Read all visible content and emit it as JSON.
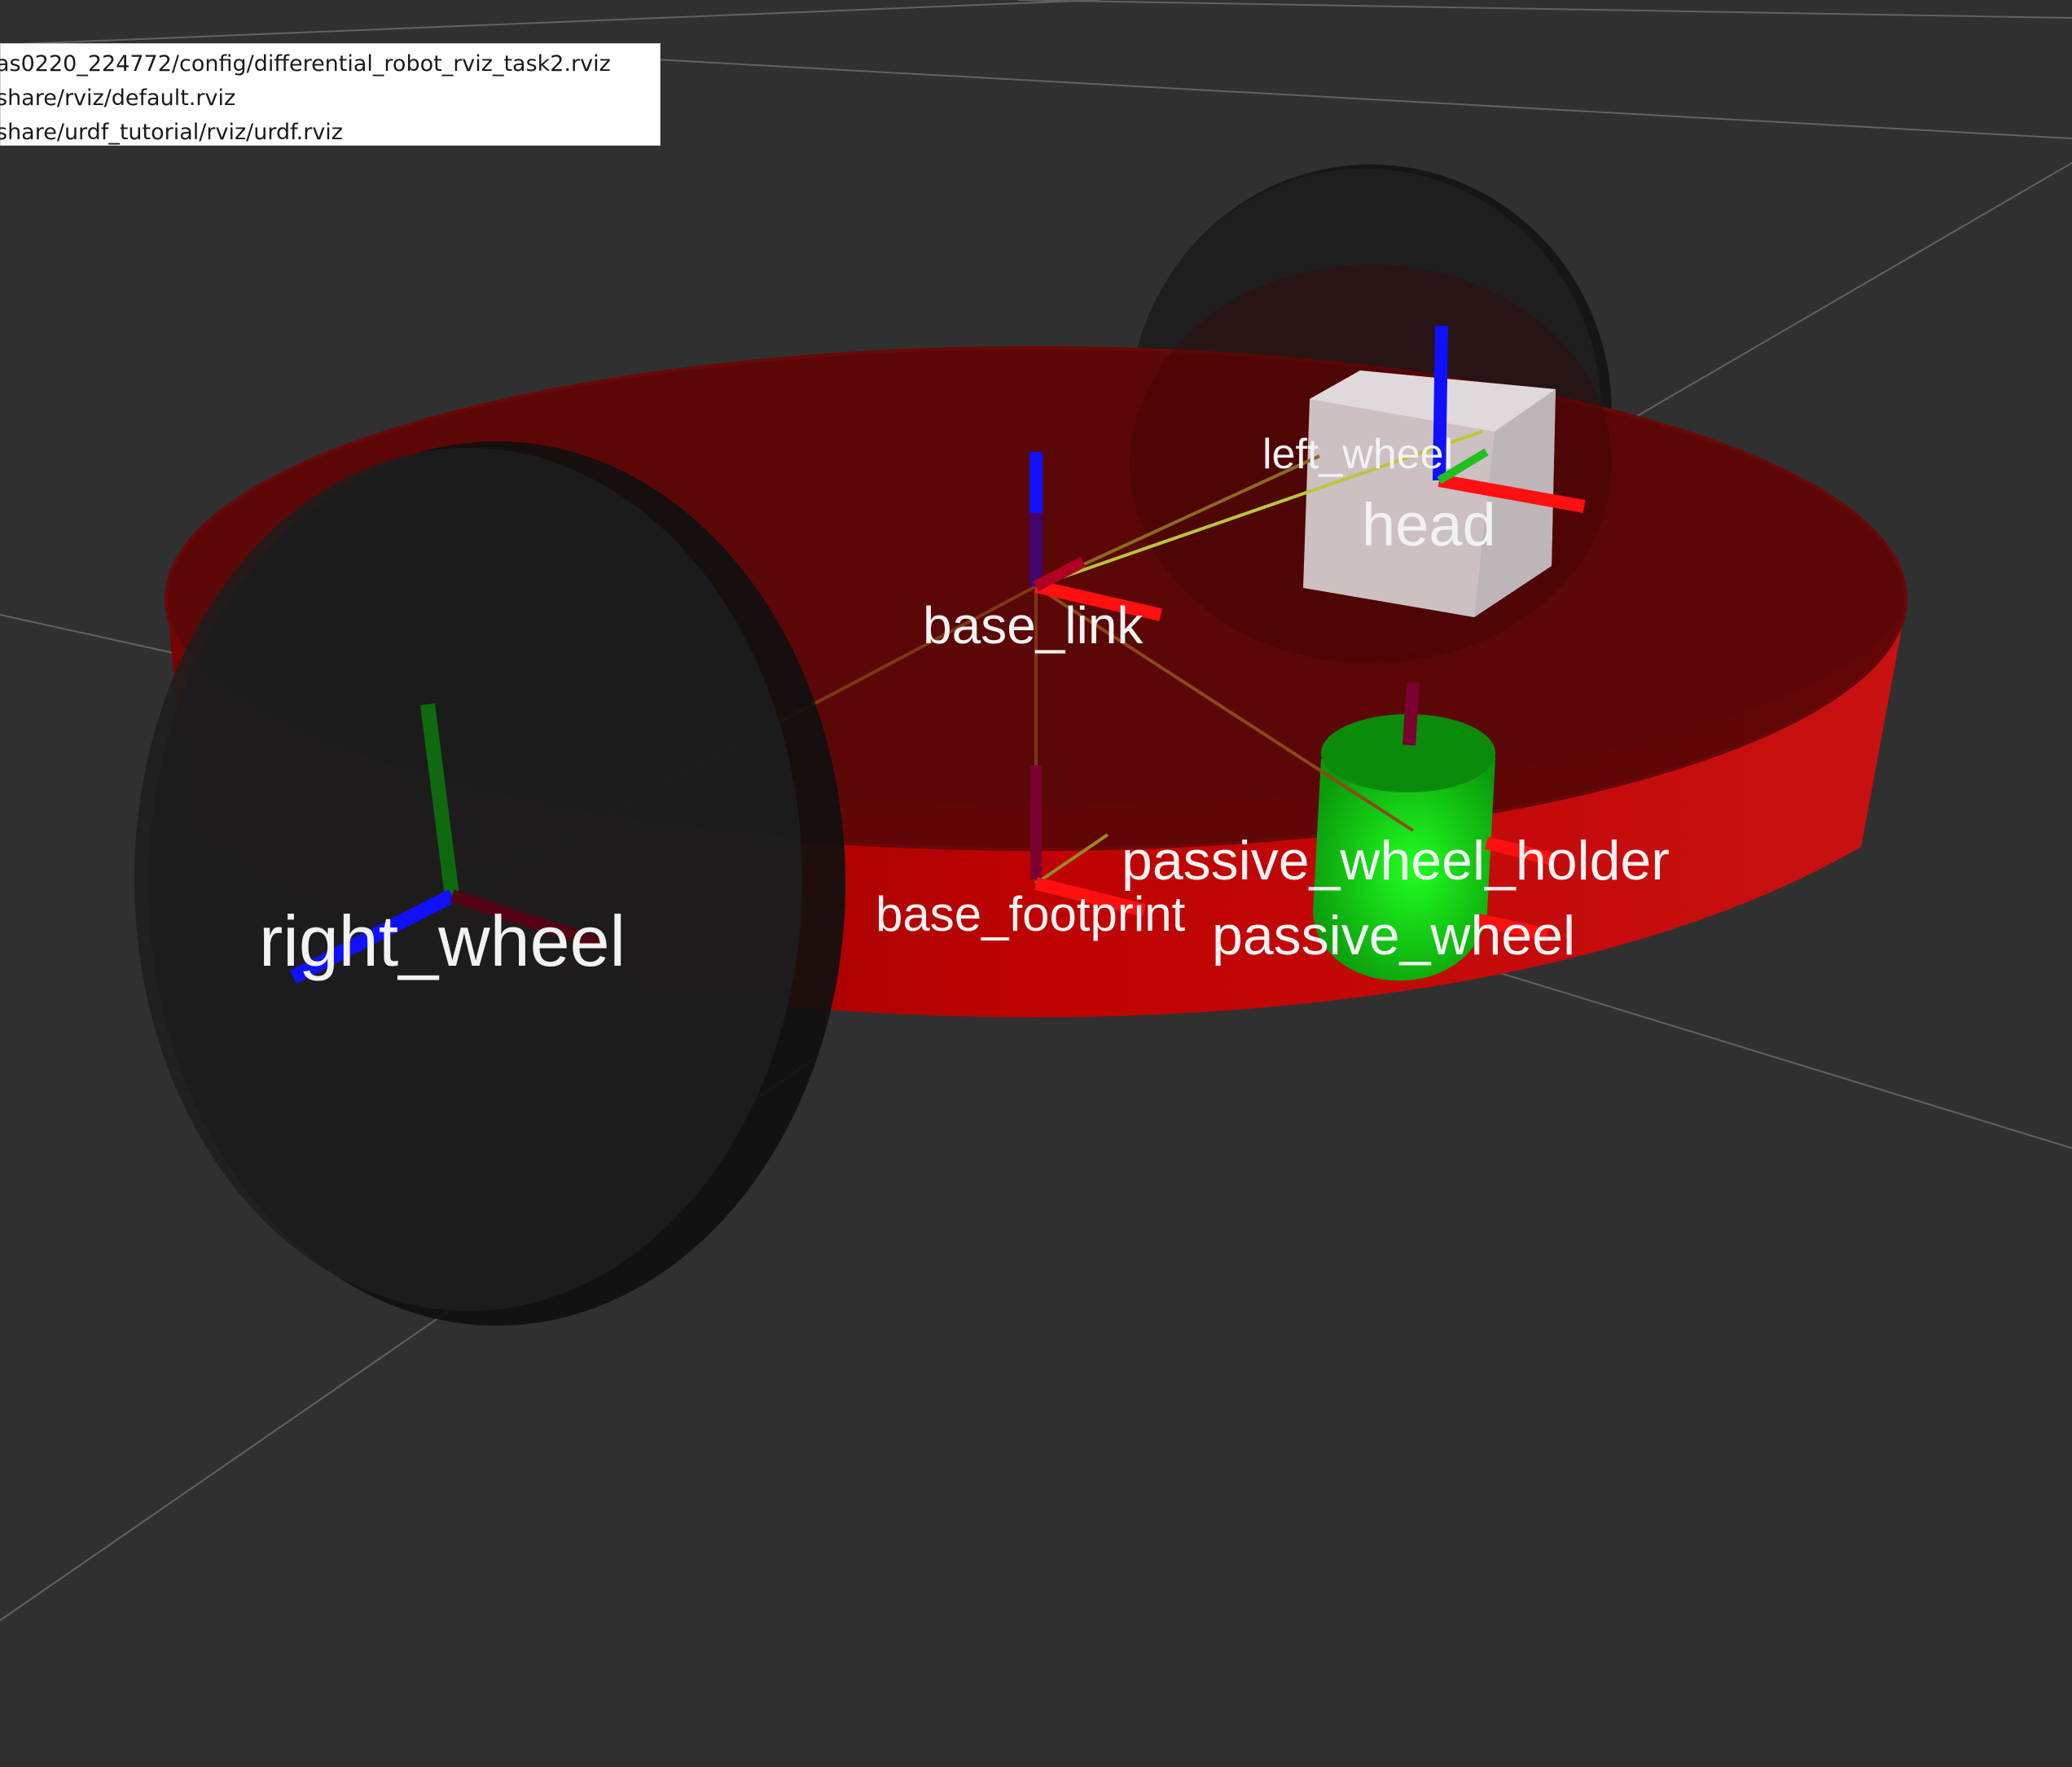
{
  "recent_files_menu": {
    "items": [
      "as0220_224772/config/differential_robot_rviz_task2.rviz",
      "share/rviz/default.rviz",
      "share/urdf_tutorial/rviz/urdf.rviz"
    ]
  },
  "scene": {
    "background_color": "#303030",
    "grid_color": "#8a8a8a",
    "frame_labels": {
      "left_wheel": "left_wheel",
      "head": "head",
      "base_link": "base_link",
      "passive_wheel_holder": "passive_wheel_holder",
      "base_footprint": "base_footprint",
      "passive_wheel": "passive_wheel",
      "right_wheel": "right_wheel"
    },
    "colors": {
      "base_body": "#c00000",
      "wheel": "#1c1c1c",
      "head_box": "#d8d2d4",
      "caster": "#14d414",
      "axis_x": "#ff0000",
      "axis_y": "#00cc00",
      "axis_z": "#0000ff"
    }
  }
}
